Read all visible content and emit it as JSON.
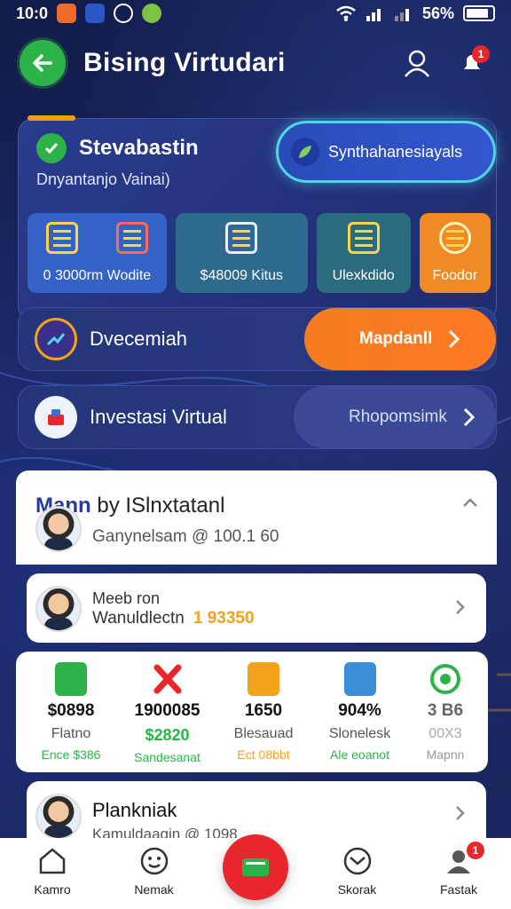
{
  "status_bar": {
    "time": "10:0",
    "battery": "56%"
  },
  "header": {
    "title": "Bising Virtudari"
  },
  "profile": {
    "name": "Stevabastin",
    "subtitle": "Dnyantanjo Vainai)",
    "sync_label": "Synthahanesiayals"
  },
  "tiles": [
    {
      "label": "0 3000rm Wodite",
      "color": "#3562c6"
    },
    {
      "label": "$48009 Kitus",
      "color": "#2e6a8e"
    },
    {
      "label": "Ulexkdido",
      "color": "#2a6b7e"
    },
    {
      "label": "Foodor",
      "color": "#f08a24"
    }
  ],
  "rows": [
    {
      "label": "Dvecemiah",
      "action": "Mapdanll"
    },
    {
      "label": "Investasi Virtual",
      "action": "Rhopomsimk"
    }
  ],
  "card_main": {
    "title_tag": "Mann",
    "title": "by ISlnxtatanl",
    "subtitle": "Ganynelsam @ 100.1 60"
  },
  "card_person": {
    "name": "Meeb ron",
    "sub": "Wanuldlectn",
    "coins": "1 93350"
  },
  "stats": [
    {
      "icon": "wallet-icon",
      "value": "$0898",
      "label": "Flatno",
      "sub": "Ence $386",
      "sub_color": "#2bb34a",
      "color": "#2bb34a"
    },
    {
      "icon": "close-icon",
      "value": "1900085",
      "label": "$2820",
      "sub": "Sandesanat",
      "sub_color": "#2bb34a",
      "color": "#e8262b"
    },
    {
      "icon": "calendar-icon",
      "value": "1650",
      "label": "Blesauad",
      "sub": "Ect 08bbt",
      "sub_color": "#f2a31b",
      "color": "#f2a31b"
    },
    {
      "icon": "document-icon",
      "value": "904%",
      "label": "Slonelesk",
      "sub": "Ale eoanot",
      "sub_color": "#2bb34a",
      "color": "#3a8fd6"
    },
    {
      "icon": "target-icon",
      "value": "3 B6",
      "label": "00X3",
      "sub": "Mapnn",
      "sub_color": "#999999",
      "color": "#2bb34a"
    }
  ],
  "card_bottom": {
    "name": "Plankniak",
    "sub": "Kamuldaagin @ 1098"
  },
  "nav": [
    {
      "label": "Kamro",
      "icon": "home-icon"
    },
    {
      "label": "Nemak",
      "icon": "smiley-icon"
    },
    {
      "label": "",
      "icon": "wallet-icon"
    },
    {
      "label": "Skorak",
      "icon": "mail-icon"
    },
    {
      "label": "Fastak",
      "icon": "profile-icon",
      "badge": "1"
    }
  ]
}
